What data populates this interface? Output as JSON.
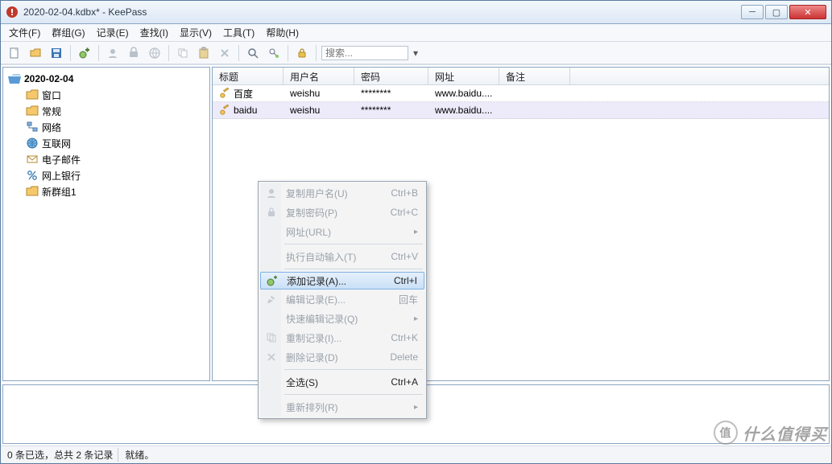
{
  "title": "2020-02-04.kdbx* - KeePass",
  "menu": {
    "file": "文件(F)",
    "group": "群组(G)",
    "entry": "记录(E)",
    "find": "查找(I)",
    "view": "显示(V)",
    "tools": "工具(T)",
    "help": "帮助(H)"
  },
  "toolbar": {
    "search_placeholder": "搜索..."
  },
  "tree": {
    "root": "2020-02-04",
    "items": [
      {
        "label": "窗口"
      },
      {
        "label": "常规"
      },
      {
        "label": "网络"
      },
      {
        "label": "互联网"
      },
      {
        "label": "电子邮件"
      },
      {
        "label": "网上银行"
      },
      {
        "label": "新群组1"
      }
    ]
  },
  "columns": {
    "title": "标题",
    "user": "用户名",
    "pass": "密码",
    "url": "网址",
    "notes": "备注"
  },
  "rows": [
    {
      "title": "百度",
      "user": "weishu",
      "pass": "********",
      "url": "www.baidu....",
      "notes": ""
    },
    {
      "title": "baidu",
      "user": "weishu",
      "pass": "********",
      "url": "www.baidu....",
      "notes": ""
    }
  ],
  "status": {
    "left": "0 条已选，总共 2 条记录",
    "right": "就绪。"
  },
  "ctx": {
    "copy_user": "复制用户名(U)",
    "copy_user_sc": "Ctrl+B",
    "copy_pass": "复制密码(P)",
    "copy_pass_sc": "Ctrl+C",
    "url": "网址(URL)",
    "autotype": "执行自动输入(T)",
    "autotype_sc": "Ctrl+V",
    "add": "添加记录(A)...",
    "add_sc": "Ctrl+I",
    "edit": "编辑记录(E)...",
    "edit_sc": "回车",
    "quickedit": "快速编辑记录(Q)",
    "dup": "重制记录(I)...",
    "dup_sc": "Ctrl+K",
    "del": "删除记录(D)",
    "del_sc": "Delete",
    "selall": "全选(S)",
    "selall_sc": "Ctrl+A",
    "reorder": "重新排列(R)"
  },
  "watermark": {
    "badge": "值",
    "text": "什么值得买"
  }
}
